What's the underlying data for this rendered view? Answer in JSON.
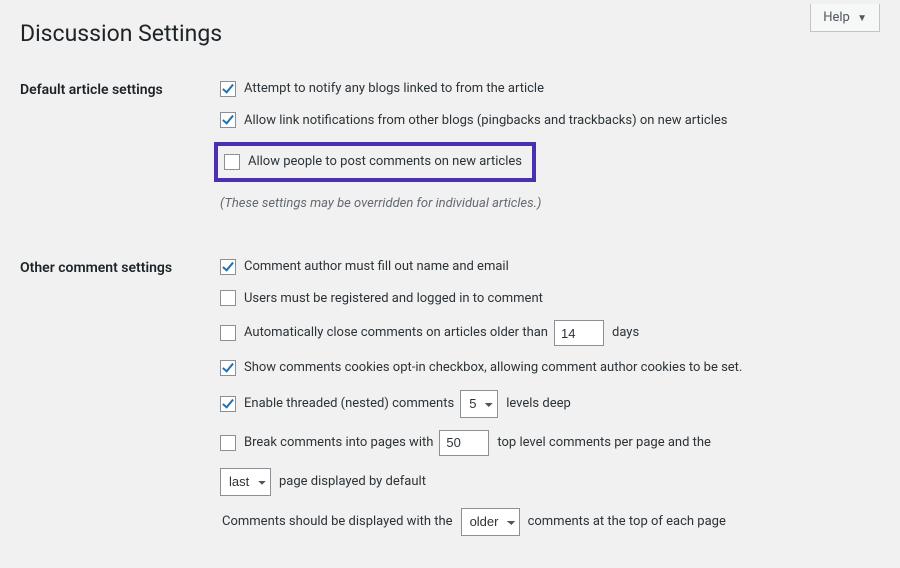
{
  "help": {
    "label": "Help"
  },
  "page_title": "Discussion Settings",
  "sections": {
    "default_article": {
      "heading": "Default article settings",
      "notify_blogs": {
        "label": "Attempt to notify any blogs linked to from the article",
        "checked": true
      },
      "allow_pingbacks": {
        "label": "Allow link notifications from other blogs (pingbacks and trackbacks) on new articles",
        "checked": true
      },
      "allow_comments": {
        "label": "Allow people to post comments on new articles",
        "checked": false
      },
      "note": "(These settings may be overridden for individual articles.)"
    },
    "other_comment": {
      "heading": "Other comment settings",
      "require_name_email": {
        "label": "Comment author must fill out name and email",
        "checked": true
      },
      "require_registration": {
        "label": "Users must be registered and logged in to comment",
        "checked": false
      },
      "auto_close": {
        "label_before": "Automatically close comments on articles older than",
        "value": "14",
        "label_after": "days",
        "checked": false
      },
      "cookies_optin": {
        "label": "Show comments cookies opt-in checkbox, allowing comment author cookies to be set.",
        "checked": true
      },
      "threaded": {
        "label_before": "Enable threaded (nested) comments",
        "value": "5",
        "label_after": "levels deep",
        "checked": true
      },
      "paginate": {
        "label_before": "Break comments into pages with",
        "value": "50",
        "label_mid": "top level comments per page and the",
        "page_select": "last",
        "label_after": "page displayed by default",
        "checked": false
      },
      "display_order": {
        "label_before": "Comments should be displayed with the",
        "value": "older",
        "label_after": "comments at the top of each page"
      }
    }
  }
}
